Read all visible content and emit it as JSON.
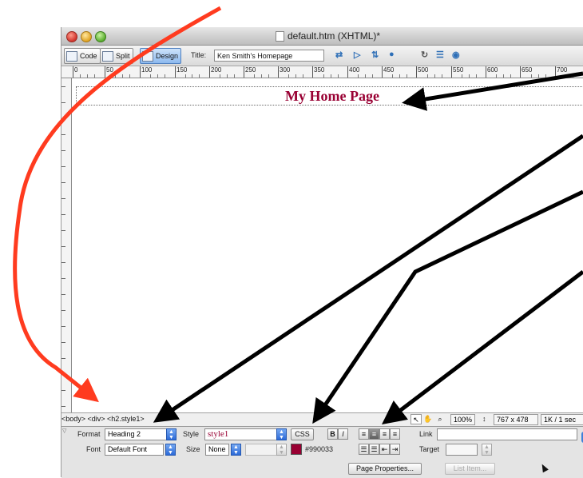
{
  "window": {
    "title": "default.htm (XHTML)*"
  },
  "toolbar": {
    "code_label": "Code",
    "split_label": "Split",
    "design_label": "Design",
    "title_label": "Title:",
    "title_value": "Ken Smith's Homepage"
  },
  "ruler": {
    "labels": [
      "0",
      "50",
      "100",
      "150",
      "200",
      "250",
      "300",
      "350",
      "400",
      "450",
      "500",
      "550",
      "600",
      "650",
      "700"
    ]
  },
  "canvas": {
    "heading": "My Home Page",
    "heading_color": "#990033"
  },
  "status": {
    "tag_selector": "<body> <div> <h2.style1>",
    "zoom": "100%",
    "window_size": "767 x 478",
    "download": "1K / 1 sec"
  },
  "properties": {
    "format_label": "Format",
    "format_value": "Heading 2",
    "style_label": "Style",
    "style_value": "style1",
    "css_button": "CSS",
    "link_label": "Link",
    "font_label": "Font",
    "font_value": "Default Font",
    "size_label": "Size",
    "size_value": "None",
    "color_value": "#990033",
    "target_label": "Target",
    "page_properties_button": "Page Properties...",
    "list_item_button": "List Item..."
  },
  "annotations": {
    "arrow_color": "#000000",
    "callout_color": "#ff3b1f"
  }
}
